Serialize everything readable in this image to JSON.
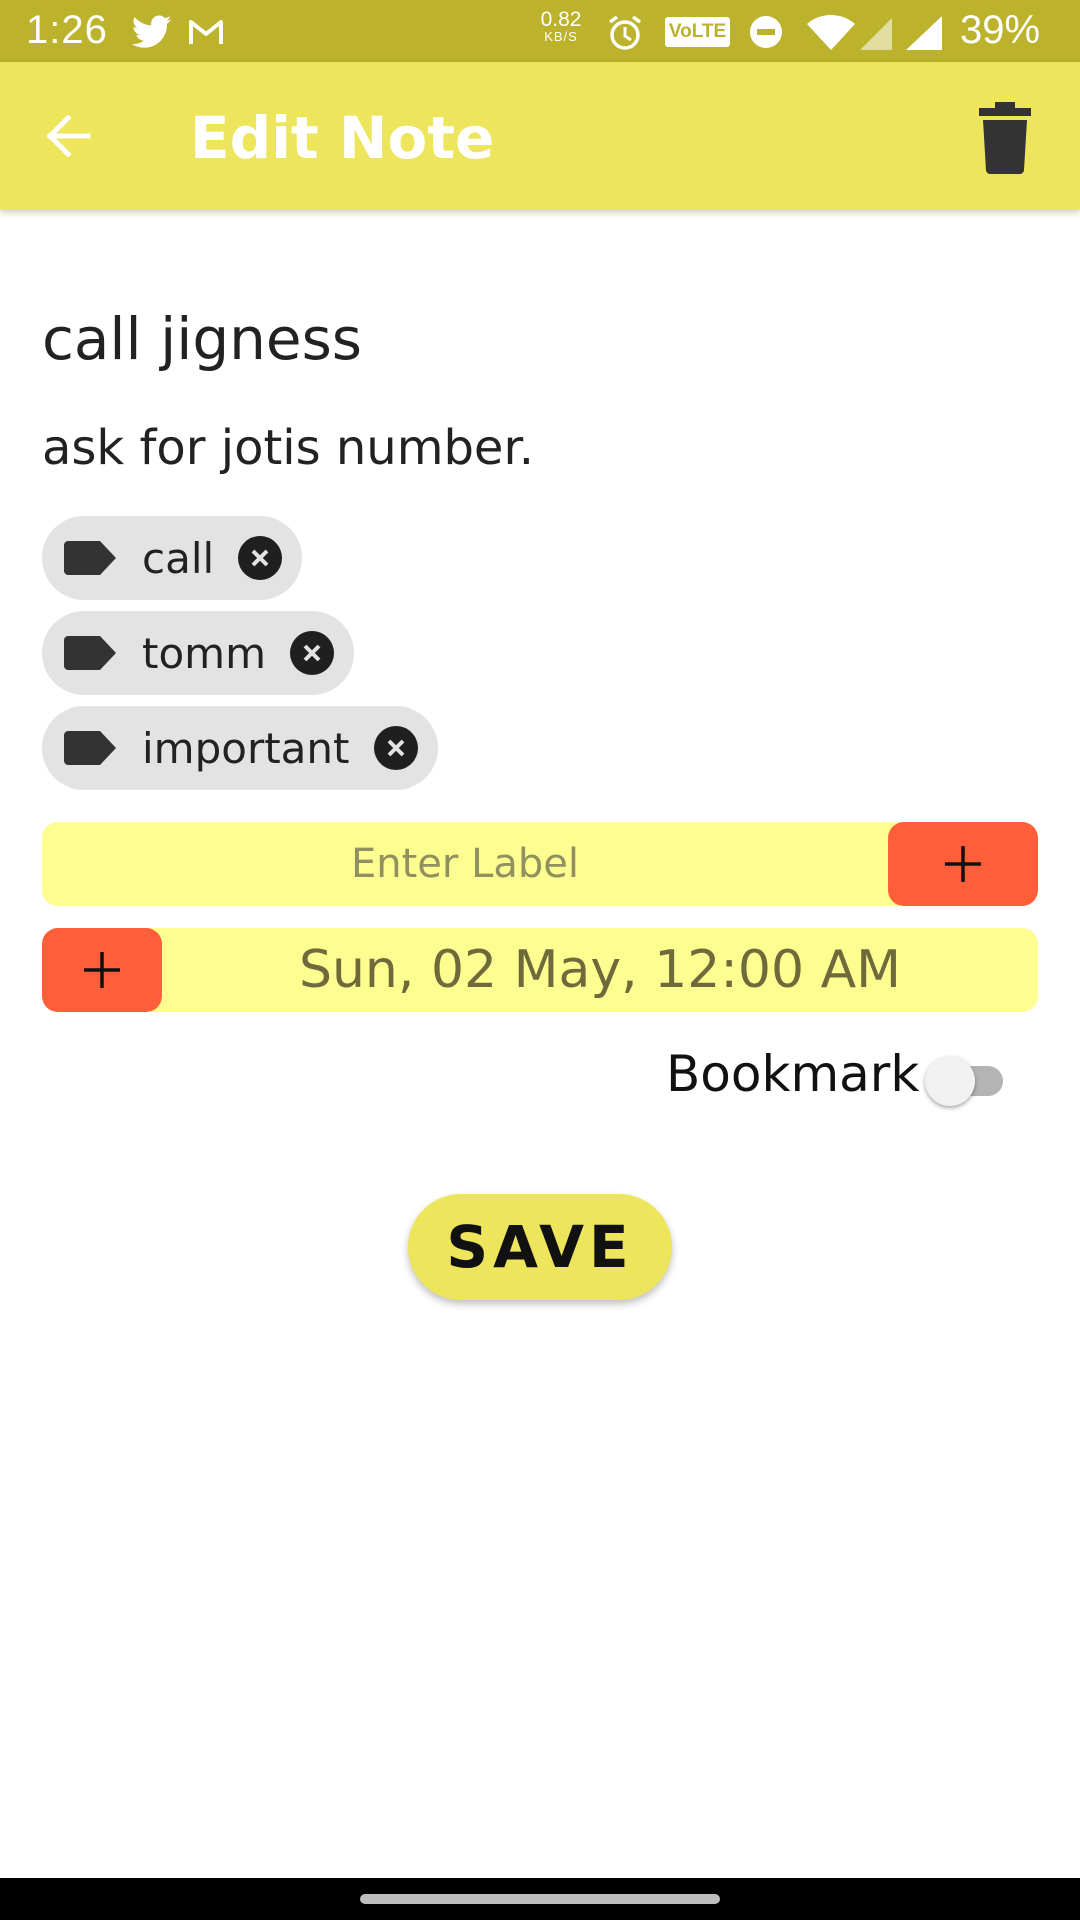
{
  "status_bar": {
    "time": "1:26",
    "net_speed_value": "0.82",
    "net_speed_unit": "KB/S",
    "volte": "VoLTE",
    "battery": "39%"
  },
  "app_bar": {
    "title": "Edit Note"
  },
  "note": {
    "title": "call jigness",
    "body": "ask for jotis number."
  },
  "labels": [
    "call",
    "tomm",
    "important"
  ],
  "label_input": {
    "placeholder": "Enter Label",
    "value": ""
  },
  "reminder": {
    "date_text": "Sun, 02 May, 12:00 AM"
  },
  "bookmark": {
    "label": "Bookmark",
    "enabled": false
  },
  "save_button": {
    "label": "SAVE"
  },
  "colors": {
    "status_bar": "#bcb22b",
    "app_bar": "#ede55b",
    "input_bg": "#fefe90",
    "accent_orange": "#fe5e3a",
    "chip_bg": "#e3e3e3"
  },
  "icons": {
    "back": "arrow-left",
    "delete": "trash-can",
    "chip": "label-tag",
    "chip_remove": "close-circle",
    "add": "plus"
  }
}
